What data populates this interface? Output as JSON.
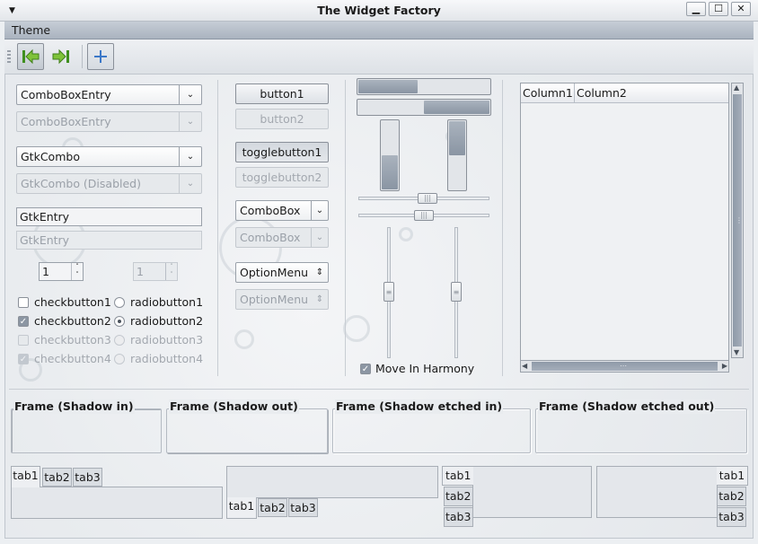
{
  "window": {
    "title": "The Widget Factory",
    "menu_icon": "triangle-down-icon",
    "controls": {
      "minimize": "▁",
      "maximize": "☐",
      "close": "✕"
    }
  },
  "menubar": {
    "items": [
      "Theme"
    ]
  },
  "toolbar": {
    "buttons": [
      "go-first-icon",
      "go-last-icon",
      "add-icon"
    ]
  },
  "col1": {
    "combo_entry": "ComboBoxEntry",
    "combo_entry_dis": "ComboBoxEntry",
    "gtk_combo": "GtkCombo",
    "gtk_combo_dis": "GtkCombo (Disabled)",
    "entry": "GtkEntry",
    "entry_dis": "GtkEntry",
    "spin": "1",
    "spin_dis": "1",
    "check1": "checkbutton1",
    "check2": "checkbutton2",
    "check3": "checkbutton3",
    "check4": "checkbutton4",
    "radio1": "radiobutton1",
    "radio2": "radiobutton2",
    "radio3": "radiobutton3",
    "radio4": "radiobutton4",
    "arrow": "⌄",
    "check_mark": "✓",
    "spin_up": "˄",
    "spin_down": "˅"
  },
  "col2": {
    "button1": "button1",
    "button2": "button2",
    "toggle1": "togglebutton1",
    "toggle2": "togglebutton2",
    "combobox": "ComboBox",
    "combobox_dis": "ComboBox",
    "option": "OptionMenu",
    "option_dis": "OptionMenu",
    "option_arrow": "⇕"
  },
  "col3": {
    "progress_h1": 0.45,
    "progress_h2": 0.5,
    "progress_v1": 0.5,
    "progress_v2": 0.5,
    "harmony_label": "Move In Harmony",
    "slider_grip": "|||"
  },
  "tree": {
    "columns": [
      "Column1",
      "Column2"
    ],
    "grip": "⋮",
    "hgrip": "⋯",
    "arrows": {
      "up": "▲",
      "down": "▼",
      "left": "◀",
      "right": "▶"
    }
  },
  "frames": [
    "Frame (Shadow in)",
    "Frame (Shadow out)",
    "Frame (Shadow etched in)",
    "Frame (Shadow etched out)"
  ],
  "tabs": [
    "tab1",
    "tab2",
    "tab3"
  ]
}
